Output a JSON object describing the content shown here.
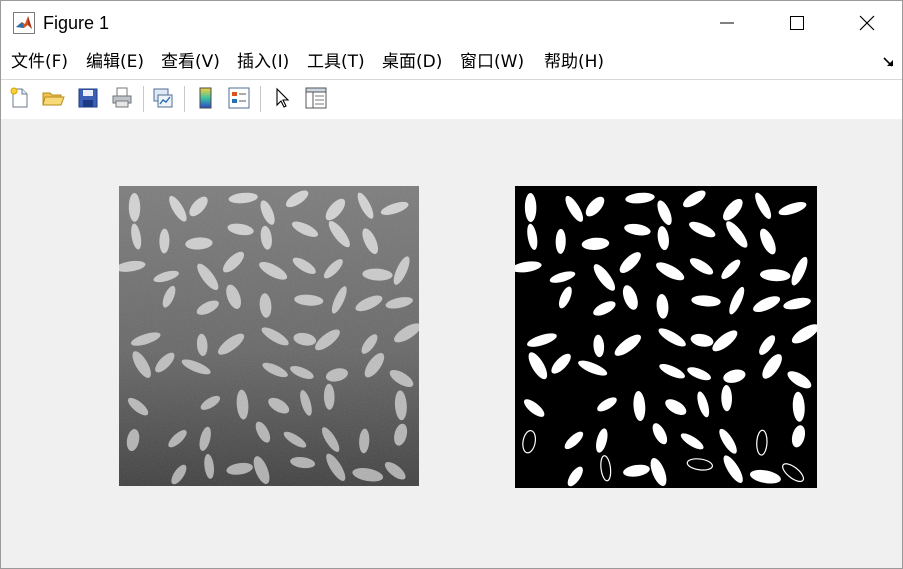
{
  "window": {
    "title": "Figure 1",
    "icon": "matlab-icon"
  },
  "controls": {
    "minimize": "minimize-icon",
    "maximize": "maximize-icon",
    "close": "close-icon"
  },
  "menu": [
    {
      "label": "文件(F)"
    },
    {
      "label": "编辑(E)"
    },
    {
      "label": "查看(V)"
    },
    {
      "label": "插入(I)"
    },
    {
      "label": "工具(T)"
    },
    {
      "label": "桌面(D)"
    },
    {
      "label": "窗口(W)"
    },
    {
      "label": "帮助(H)"
    }
  ],
  "toolbar": [
    "new-figure-icon",
    "open-file-icon",
    "save-figure-icon",
    "print-figure-icon",
    "link-plot-icon",
    "insert-colorbar-icon",
    "insert-legend-icon",
    "edit-plot-icon",
    "property-inspector-icon"
  ],
  "images": [
    {
      "name": "original-grayscale-image",
      "kind": "grayscale"
    },
    {
      "name": "binary-thresholded-image",
      "kind": "binary"
    }
  ]
}
